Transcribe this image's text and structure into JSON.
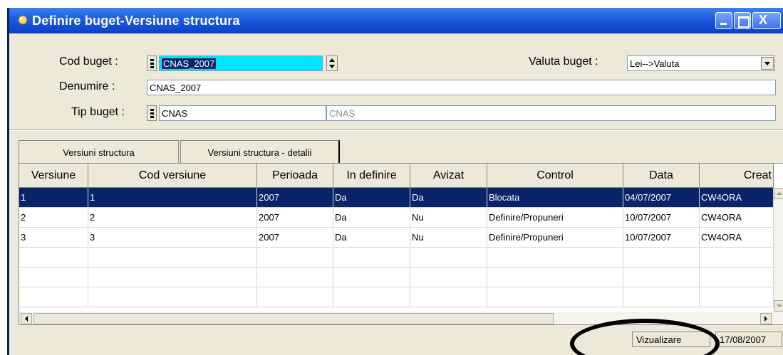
{
  "window": {
    "title": "Definire buget-Versiune structura",
    "close_glyph": "X"
  },
  "form": {
    "cod_buget": {
      "label": "Cod buget :",
      "value": "CNAS_2007"
    },
    "valuta_buget": {
      "label": "Valuta buget :",
      "value": "Lei-->Valuta"
    },
    "denumire": {
      "label": "Denumire :",
      "value": "CNAS_2007"
    },
    "tip_buget": {
      "label": "Tip buget :",
      "code": "CNAS",
      "description": "CNAS"
    }
  },
  "tabs": [
    {
      "label": "Versiuni structura",
      "active": true
    },
    {
      "label": "Versiuni structura - detalii",
      "active": false
    }
  ],
  "grid": {
    "columns": [
      "Versiune",
      "Cod versiune",
      "Perioada",
      "In definire",
      "Avizat",
      "Control",
      "Data",
      "Creat"
    ],
    "rows": [
      [
        "1",
        "1",
        "2007",
        "Da",
        "Da",
        "Blocata",
        "04/07/2007",
        "CW4ORA"
      ],
      [
        "2",
        "2",
        "2007",
        "Da",
        "Nu",
        "Definire/Propuneri",
        "10/07/2007",
        "CW4ORA"
      ],
      [
        "3",
        "3",
        "2007",
        "Da",
        "Nu",
        "Definire/Propuneri",
        "10/07/2007",
        "CW4ORA"
      ],
      [
        "",
        "",
        "",
        "",
        "",
        "",
        "",
        ""
      ],
      [
        "",
        "",
        "",
        "",
        "",
        "",
        "",
        ""
      ],
      [
        "",
        "",
        "",
        "",
        "",
        "",
        "",
        ""
      ]
    ],
    "selected_row": 0
  },
  "status": {
    "mode": "Vizualizare",
    "date": "17/08/2007"
  }
}
